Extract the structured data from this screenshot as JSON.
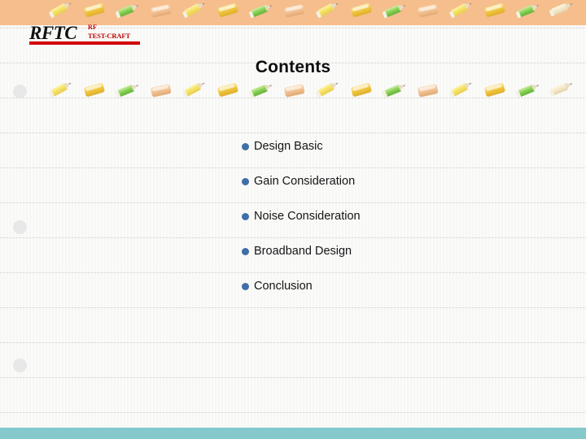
{
  "slide": {
    "title": "Contents",
    "logo": {
      "mark": "RFTC",
      "sub_line1": "RF",
      "sub_line2": "TEST-CRAFT"
    },
    "bullets": [
      {
        "label": "Design Basic"
      },
      {
        "label": "Gain Consideration"
      },
      {
        "label": "Noise Consideration"
      },
      {
        "label": "Broadband Design"
      },
      {
        "label": "Conclusion"
      }
    ],
    "colors": {
      "top_band": "#F5BE8C",
      "footer_bar": "#85C9CC",
      "bullet": "#3E6FA6",
      "logo_red": "#D10000",
      "background": "#F7F7F5",
      "left_dot": "#E8E8E8"
    },
    "decor": {
      "top_strip_icons": [
        "pencil-yellow",
        "eraser-gold",
        "pencil-green",
        "eraser-tan",
        "pencil-yellow",
        "eraser-gold",
        "pencil-green",
        "eraser-tan",
        "pencil-yellow",
        "eraser-gold",
        "pencil-green",
        "eraser-tan",
        "pencil-yellow",
        "eraser-gold",
        "pencil-green",
        "pencil-cream"
      ],
      "mid_strip_icons": [
        "pencil-yellow",
        "eraser-gold",
        "pencil-green",
        "eraser-tan",
        "pencil-yellow",
        "eraser-gold",
        "pencil-green",
        "eraser-tan",
        "pencil-yellow",
        "eraser-gold",
        "pencil-green",
        "eraser-tan",
        "pencil-yellow",
        "eraser-gold",
        "pencil-green",
        "pencil-cream"
      ],
      "left_dots": 3
    }
  }
}
